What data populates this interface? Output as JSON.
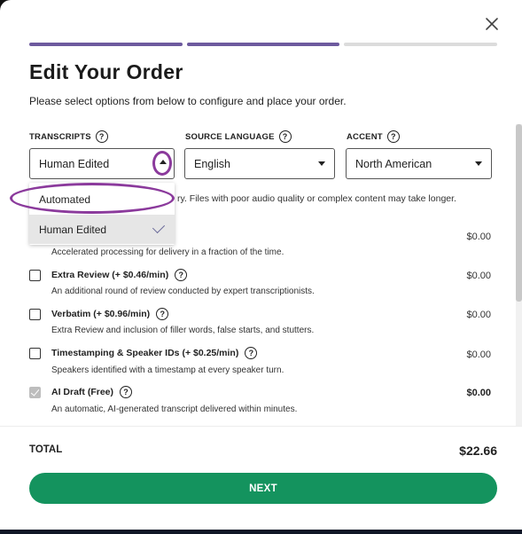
{
  "header": {
    "title": "Edit Your Order",
    "subtitle": "Please select options from below to configure and place your order."
  },
  "progress": {
    "steps_total": 3,
    "steps_completed": 2,
    "active_color": "#6d5a9e",
    "inactive_color": "#dcdcdc"
  },
  "fields": {
    "transcripts": {
      "label": "TRANSCRIPTS",
      "value": "Human Edited"
    },
    "source_language": {
      "label": "SOURCE LANGUAGE",
      "value": "English"
    },
    "accent": {
      "label": "ACCENT",
      "value": "North American"
    }
  },
  "help_glyph": "?",
  "dropdown": {
    "options": [
      "Automated",
      "Human Edited"
    ],
    "selected": "Human Edited",
    "highlight_color": "#8b3a9c"
  },
  "turnaround_note": "ry. Files with poor audio quality or complex content may take longer.",
  "options": [
    {
      "label": "",
      "price": "$0.00",
      "description": "Accelerated processing for delivery in a fraction of the time.",
      "checked": false
    },
    {
      "label": "Extra Review (+ $0.46/min)",
      "price": "$0.00",
      "description": "An additional round of review conducted by expert transcriptionists.",
      "checked": false
    },
    {
      "label": "Verbatim (+ $0.96/min)",
      "price": "$0.00",
      "description": "Extra Review and inclusion of filler words, false starts, and stutters.",
      "checked": false
    },
    {
      "label": "Timestamping & Speaker IDs (+ $0.25/min)",
      "price": "$0.00",
      "description": "Speakers identified with a timestamp at every speaker turn.",
      "checked": false
    },
    {
      "label": "AI Draft (Free)",
      "price": "$0.00",
      "description": "An automatic, AI-generated transcript delivered within minutes.",
      "checked": true
    }
  ],
  "footer": {
    "total_label": "TOTAL",
    "total_value": "$22.66",
    "next_label": "NEXT",
    "next_color": "#14935e"
  }
}
